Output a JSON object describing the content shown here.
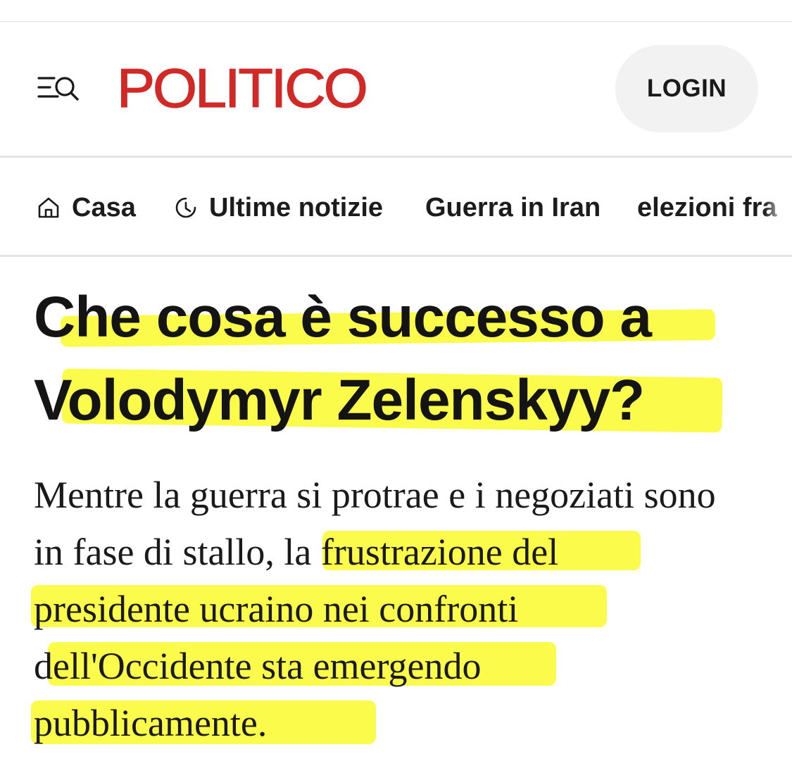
{
  "header": {
    "logo_text": "POLITICO",
    "login_label": "LOGIN",
    "menu_icon": "menu-search-icon"
  },
  "nav": {
    "items": [
      {
        "label": "Casa",
        "icon": "home-icon"
      },
      {
        "label": "Ultime notizie",
        "icon": "clock-icon"
      },
      {
        "label": "Guerra in Iran"
      },
      {
        "label": "elezioni fra"
      }
    ]
  },
  "article": {
    "headline_lines": [
      "Che cosa è successo a",
      "Volodymyr Zelenskyy?"
    ],
    "dek_lines": [
      {
        "text": "Mentre la guerra si protrae e i negoziati sono"
      },
      {
        "prefix": "in fase di stallo, la ",
        "highlighted": "frustrazione del"
      },
      {
        "highlighted": "presidente ucraino nei confronti"
      },
      {
        "prefix": "d",
        "highlighted": "ell'Occidente sta emergendo"
      },
      {
        "highlighted": "pubblicamente."
      }
    ]
  },
  "colors": {
    "brand_red": "#d12a26",
    "highlight_yellow": "#fafa2d",
    "login_bg": "#f2f2f2"
  }
}
